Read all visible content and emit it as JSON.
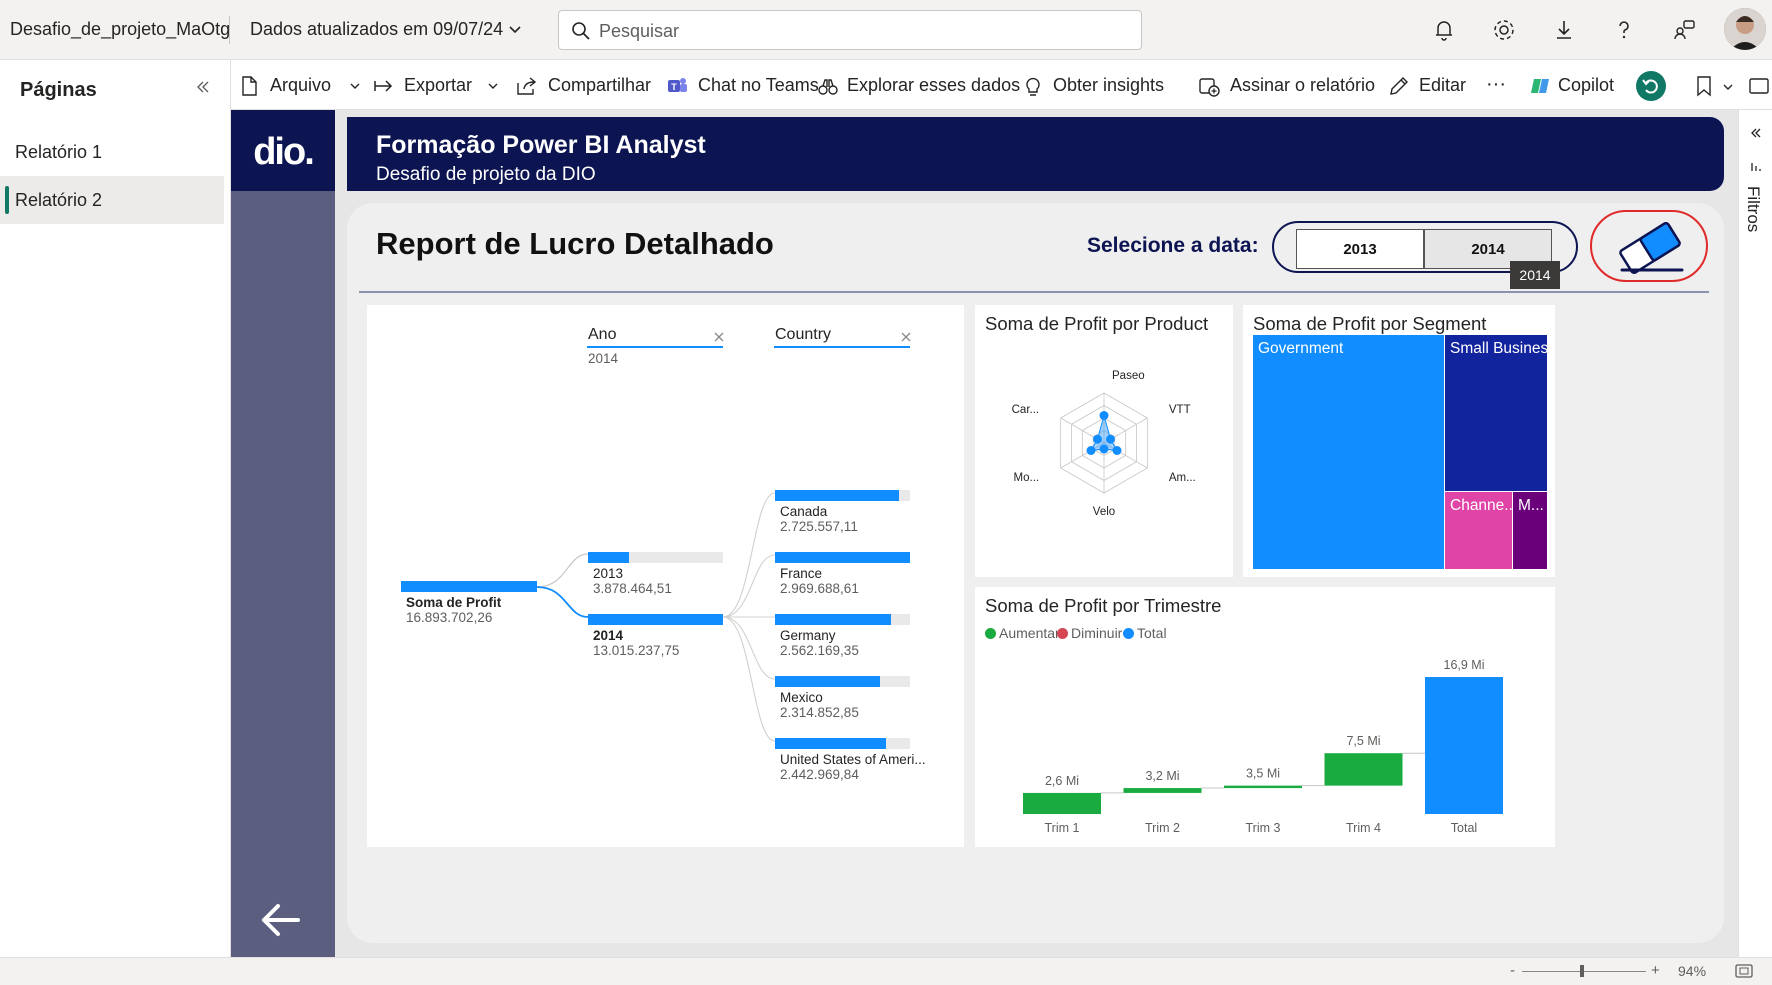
{
  "app": {
    "report_name": "Desafio_de_projeto_MaOtg",
    "updated_text": "Dados atualizados em 09/07/24",
    "search_placeholder": "Pesquisar"
  },
  "pages_pane": {
    "title": "Páginas",
    "items": [
      {
        "label": "Relatório 1",
        "active": false
      },
      {
        "label": "Relatório 2",
        "active": true
      }
    ]
  },
  "actions": {
    "arquivo": "Arquivo",
    "exportar": "Exportar",
    "compartilhar": "Compartilhar",
    "chat_teams": "Chat no Teams",
    "explorar": "Explorar esses dados",
    "insights": "Obter insights",
    "assinar": "Assinar o relatório",
    "editar": "Editar",
    "more": "···",
    "copilot": "Copilot"
  },
  "report": {
    "header_title": "Formação Power BI Analyst",
    "header_subtitle": "Desafio de projeto da DIO",
    "logo_text": "dio.",
    "title": "Report de Lucro Detalhado",
    "slicer_label": "Selecione a data:",
    "slicer_options": [
      "2013",
      "2014"
    ],
    "tooltip": "2014"
  },
  "decomposition": {
    "level1_header": "Ano",
    "level1_selected": "2014",
    "level2_header": "Country",
    "root": {
      "label": "Soma de Profit",
      "value": "16.893.702,26"
    },
    "years": [
      {
        "label": "2013",
        "value": "3.878.464,51",
        "fraction": 0.3
      },
      {
        "label": "2014",
        "value": "13.015.237,75",
        "fraction": 1.0
      }
    ],
    "countries": [
      {
        "label": "Canada",
        "value": "2.725.557,11",
        "fraction": 0.92
      },
      {
        "label": "France",
        "value": "2.969.688,61",
        "fraction": 1.0
      },
      {
        "label": "Germany",
        "value": "2.562.169,35",
        "fraction": 0.86
      },
      {
        "label": "Mexico",
        "value": "2.314.852,85",
        "fraction": 0.78
      },
      {
        "label": "United States of Ameri...",
        "value": "2.442.969,84",
        "fraction": 0.82
      }
    ]
  },
  "radar": {
    "title": "Soma de Profit por Product",
    "axes": [
      "Paseo",
      "VTT",
      "Am...",
      "Velo",
      "Mo...",
      "Car..."
    ],
    "values": [
      0.55,
      0.15,
      0.3,
      0.12,
      0.3,
      0.15
    ]
  },
  "treemap": {
    "title": "Soma de Profit por Segment",
    "segments": [
      {
        "label": "Government",
        "color": "#118dff"
      },
      {
        "label": "Small Business",
        "color": "#12239e"
      },
      {
        "label": "Channe...",
        "color": "#e044a7"
      },
      {
        "label": "M...",
        "color": "#6b007b"
      }
    ]
  },
  "chart_data": {
    "type": "bar",
    "title": "Soma de Profit por Trimestre",
    "legend": [
      "Aumentar",
      "Diminuir",
      "Total"
    ],
    "legend_colors": [
      "#1aab40",
      "#d64554",
      "#118dff"
    ],
    "categories": [
      "Trim 1",
      "Trim 2",
      "Trim 3",
      "Trim 4",
      "Total"
    ],
    "values": [
      2.6,
      0.6,
      0.3,
      4.0,
      16.9
    ],
    "cumulative": [
      2.6,
      3.2,
      3.5,
      7.5,
      16.9
    ],
    "data_labels": [
      "2,6 Mi",
      "3,2 Mi",
      "3,5 Mi",
      "7,5 Mi",
      "16,9 Mi"
    ],
    "kinds": [
      "increase",
      "increase",
      "increase",
      "increase",
      "total"
    ]
  },
  "filters_label": "Filtros",
  "status": {
    "zoom": "94%",
    "minus": "-",
    "plus": "+"
  }
}
